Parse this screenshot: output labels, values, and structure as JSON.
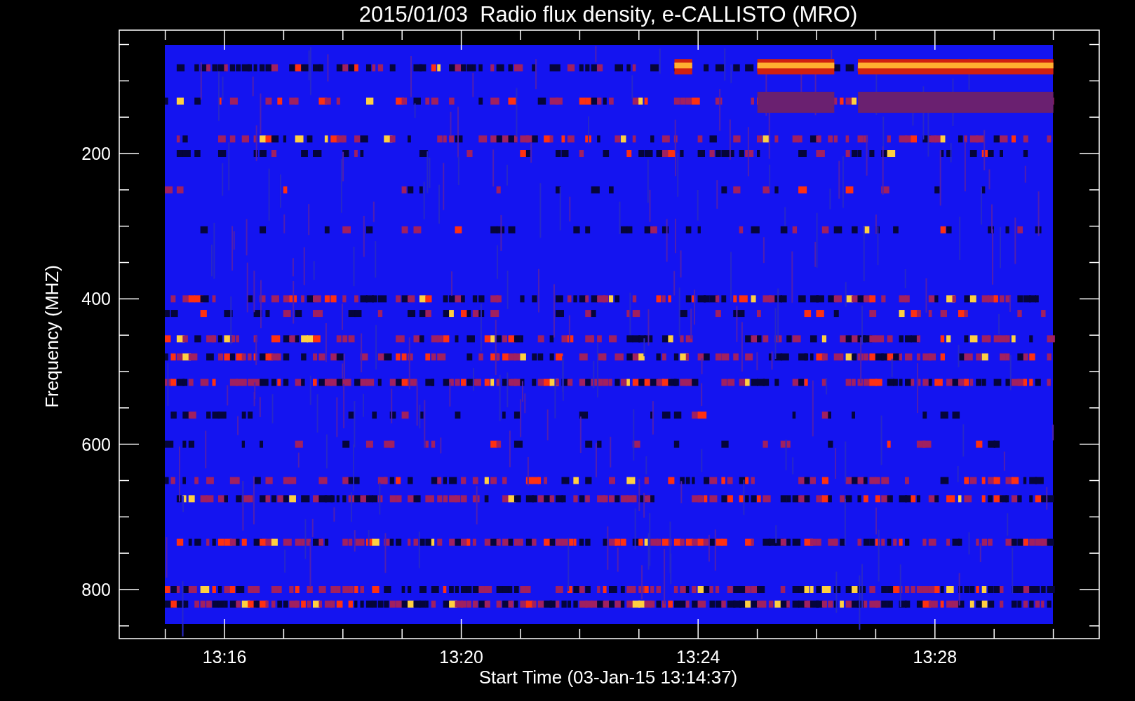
{
  "title": "2015/01/03  Radio flux density, e-CALLISTO (MRO)",
  "y_axis": {
    "label": "Frequency (MHZ)",
    "ticks": [
      "200",
      "400",
      "600",
      "800"
    ]
  },
  "x_axis": {
    "label": "Start Time (03-Jan-15 13:14:37)",
    "ticks": [
      "13:16",
      "13:20",
      "13:24",
      "13:28"
    ]
  }
}
